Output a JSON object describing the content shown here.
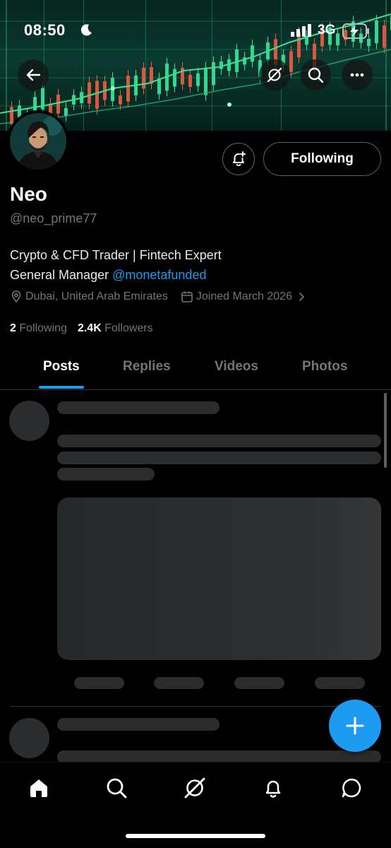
{
  "status_bar": {
    "time": "08:50",
    "network": "3G"
  },
  "profile": {
    "name": "Neo",
    "handle": "@neo_prime77",
    "bio_line1": "Crypto & CFD Trader | Fintech Expert",
    "bio_line2_prefix": "General Manager ",
    "bio_mention": "@monetafunded",
    "location": "Dubai, United Arab Emirates",
    "joined": "Joined March 2026",
    "following_count": "2",
    "following_label": "Following",
    "followers_count": "2.4K",
    "followers_label": "Followers",
    "following_button": "Following"
  },
  "tabs": [
    {
      "label": "Posts",
      "active": true
    },
    {
      "label": "Replies",
      "active": false
    },
    {
      "label": "Videos",
      "active": false
    },
    {
      "label": "Photos",
      "active": false
    }
  ],
  "nav": [
    "home-icon",
    "search-icon",
    "grok-icon",
    "notifications-icon",
    "messages-icon"
  ],
  "colors": {
    "accent": "#1d9bf0",
    "background": "#000000",
    "secondary_text": "#71767b"
  }
}
